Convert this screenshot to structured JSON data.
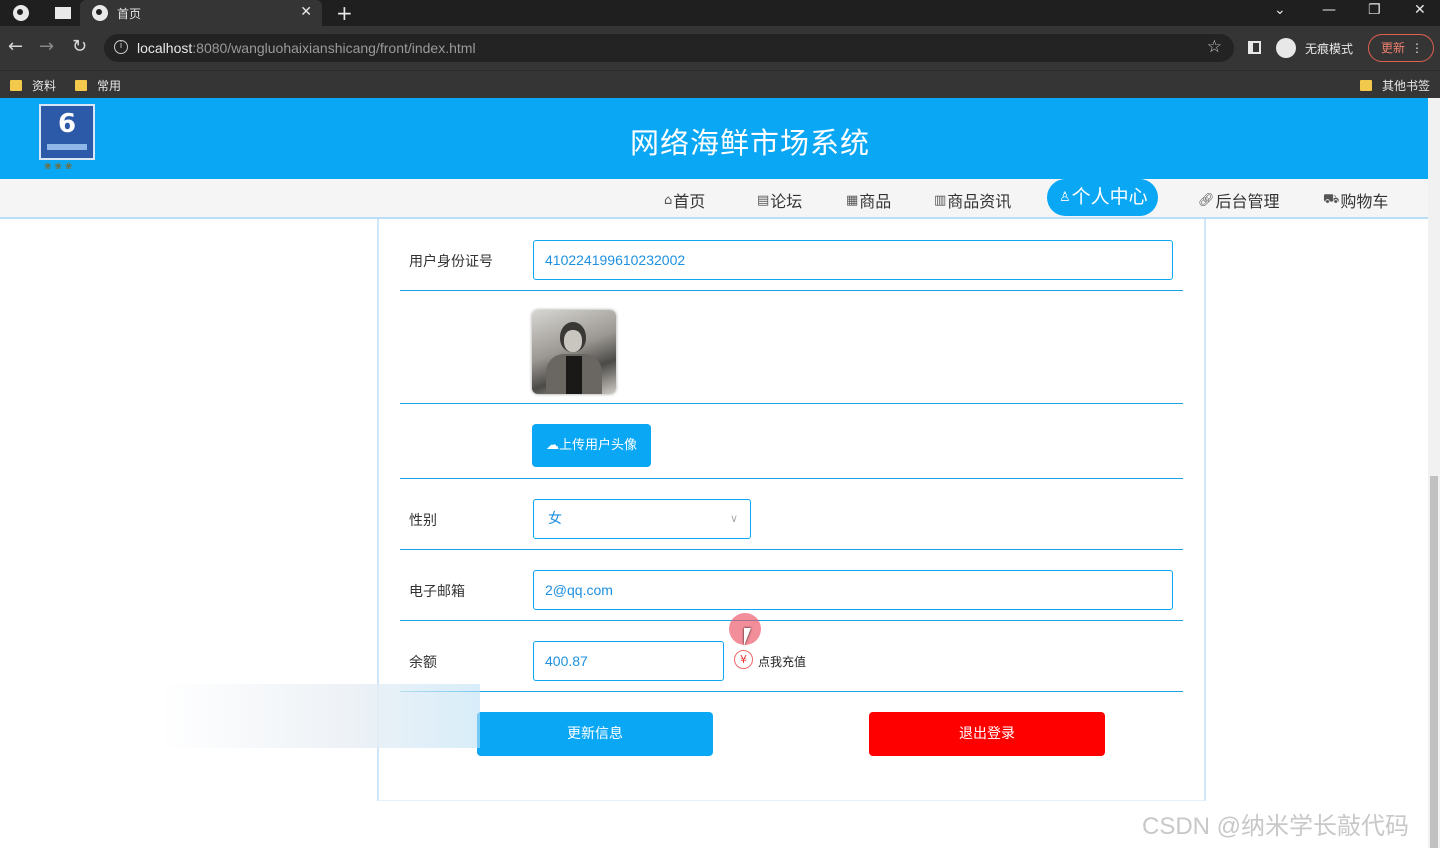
{
  "browser": {
    "tab_title": "首页",
    "tab_close": "✕",
    "new_tab": "+",
    "url_host": "localhost",
    "url_path": ":8080/wangluohaixianshicang/front/index.html",
    "incognito_label": "无痕模式",
    "update_label": "更新",
    "bookmarks": [
      "资料",
      "常用"
    ],
    "other_bookmarks": "其他书签"
  },
  "site": {
    "title": "网络海鲜市场系统",
    "nav": [
      {
        "label": "首页",
        "icon": "home-icon"
      },
      {
        "label": "论坛",
        "icon": "forum-icon"
      },
      {
        "label": "商品",
        "icon": "gift-icon"
      },
      {
        "label": "商品资讯",
        "icon": "news-icon"
      },
      {
        "label": "个人中心",
        "icon": "user-icon",
        "active": true
      },
      {
        "label": "后台管理",
        "icon": "link-icon"
      },
      {
        "label": "购物车",
        "icon": "cart-icon"
      }
    ]
  },
  "profile": {
    "id_label": "用户身份证号",
    "id_value": "410224199610232002",
    "upload_label": "上传用户头像",
    "gender_label": "性别",
    "gender_value": "女",
    "email_label": "电子邮箱",
    "email_value": "2@qq.com",
    "balance_label": "余额",
    "balance_value": "400.87",
    "recharge_label": "点我充值",
    "update_button": "更新信息",
    "logout_button": "退出登录"
  },
  "watermark": "CSDN @纳米学长敲代码",
  "colors": {
    "primary": "#0aa7f5",
    "danger": "#ff0000",
    "chrome_dark": "#353535"
  }
}
